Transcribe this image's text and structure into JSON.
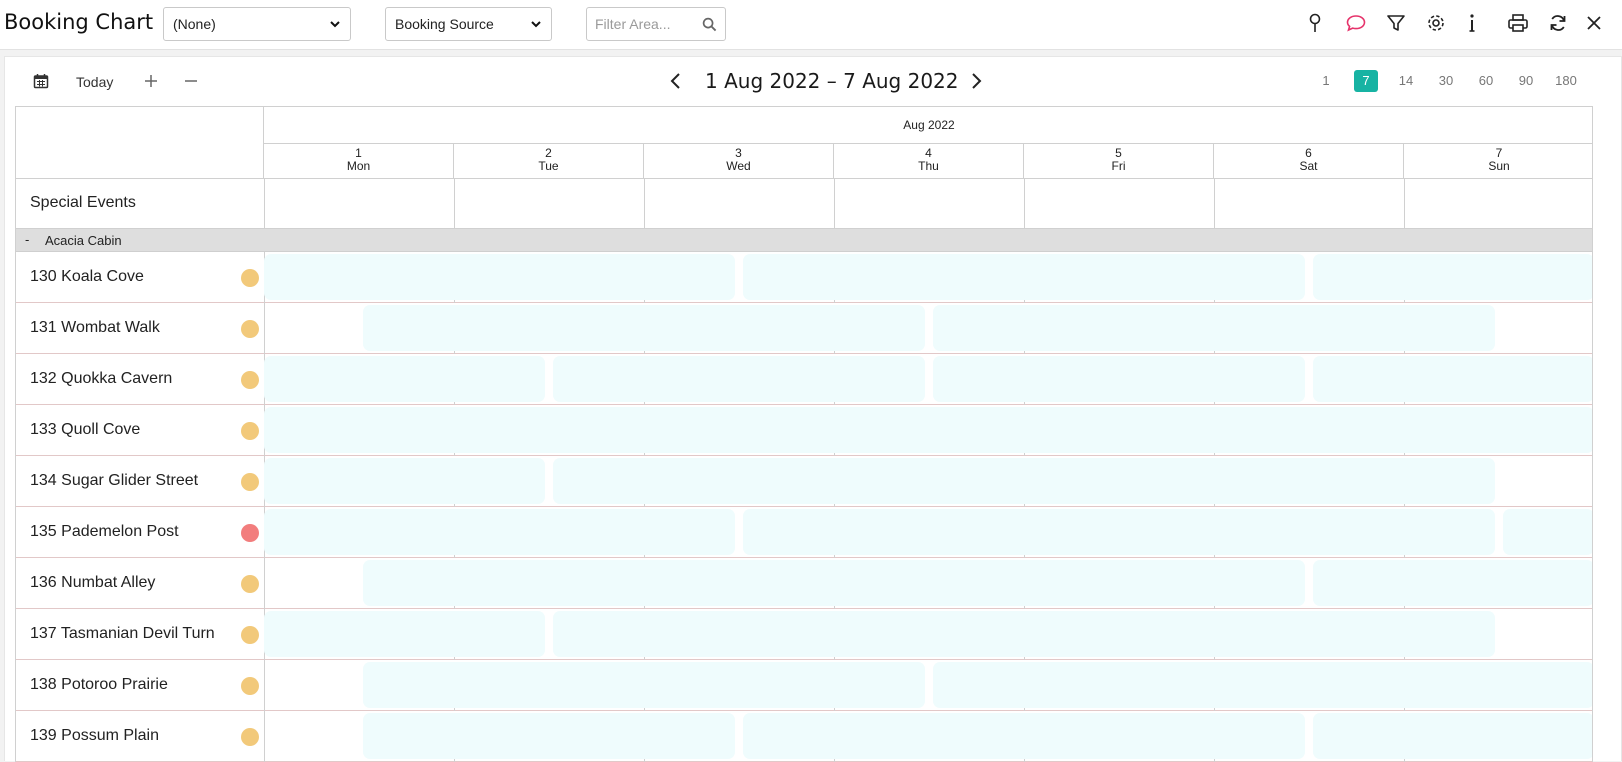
{
  "header": {
    "title": "Booking Chart",
    "select_none": "(None)",
    "select_source": "Booking Source",
    "filter_placeholder": "Filter Area..."
  },
  "icons": [
    "map-pin-icon",
    "chat-icon",
    "filter-icon",
    "gear-icon",
    "info-icon",
    "print-icon",
    "refresh-icon",
    "close-icon"
  ],
  "colors": {
    "accent": "#17b3a3",
    "status_yellow": "#f2c97a",
    "status_red": "#f27d7d",
    "booking_fill": "#effcfd",
    "chat_icon": "#e6336b"
  },
  "toolbar": {
    "today_label": "Today",
    "date_range": "1 Aug 2022 – 7 Aug 2022",
    "spans": [
      "1",
      "7",
      "14",
      "30",
      "60",
      "90",
      "180"
    ],
    "active_span": "7"
  },
  "chart": {
    "month_label": "Aug 2022",
    "days": [
      {
        "num": "1",
        "dow": "Mon"
      },
      {
        "num": "2",
        "dow": "Tue"
      },
      {
        "num": "3",
        "dow": "Wed"
      },
      {
        "num": "4",
        "dow": "Thu"
      },
      {
        "num": "5",
        "dow": "Fri"
      },
      {
        "num": "6",
        "dow": "Sat"
      },
      {
        "num": "7",
        "dow": "Sun"
      }
    ],
    "special_events_label": "Special Events",
    "group": {
      "toggle": "-",
      "label": "Acacia Cabin"
    },
    "rooms": [
      {
        "name": "130 Koala Cove",
        "status": "yellow",
        "bookings": [
          [
            1,
            3.5
          ],
          [
            3.5,
            6.5
          ],
          [
            6.5,
            8
          ]
        ]
      },
      {
        "name": "131 Wombat Walk",
        "status": "yellow",
        "bookings": [
          [
            1.5,
            4.5
          ],
          [
            4.5,
            7.5
          ]
        ]
      },
      {
        "name": "132 Quokka Cavern",
        "status": "yellow",
        "bookings": [
          [
            1,
            2.5
          ],
          [
            2.5,
            4.5
          ],
          [
            4.5,
            6.5
          ],
          [
            6.5,
            8
          ]
        ]
      },
      {
        "name": "133 Quoll Cove",
        "status": "yellow",
        "bookings": [
          [
            1,
            8
          ]
        ]
      },
      {
        "name": "134 Sugar Glider Street",
        "status": "yellow",
        "bookings": [
          [
            1,
            2.5
          ],
          [
            2.5,
            7.5
          ]
        ]
      },
      {
        "name": "135 Pademelon Post",
        "status": "red",
        "bookings": [
          [
            1,
            3.5
          ],
          [
            3.5,
            7.5
          ],
          [
            7.5,
            8
          ]
        ]
      },
      {
        "name": "136 Numbat Alley",
        "status": "yellow",
        "bookings": [
          [
            1.5,
            6.5
          ],
          [
            6.5,
            8
          ]
        ]
      },
      {
        "name": "137 Tasmanian Devil Turn",
        "status": "yellow",
        "bookings": [
          [
            1,
            2.5
          ],
          [
            2.5,
            7.5
          ]
        ]
      },
      {
        "name": "138 Potoroo Prairie",
        "status": "yellow",
        "bookings": [
          [
            1.5,
            4.5
          ],
          [
            4.5,
            8
          ]
        ]
      },
      {
        "name": "139 Possum Plain",
        "status": "yellow",
        "bookings": [
          [
            1.5,
            3.5
          ],
          [
            3.5,
            6.5
          ],
          [
            6.5,
            8
          ]
        ]
      }
    ]
  }
}
